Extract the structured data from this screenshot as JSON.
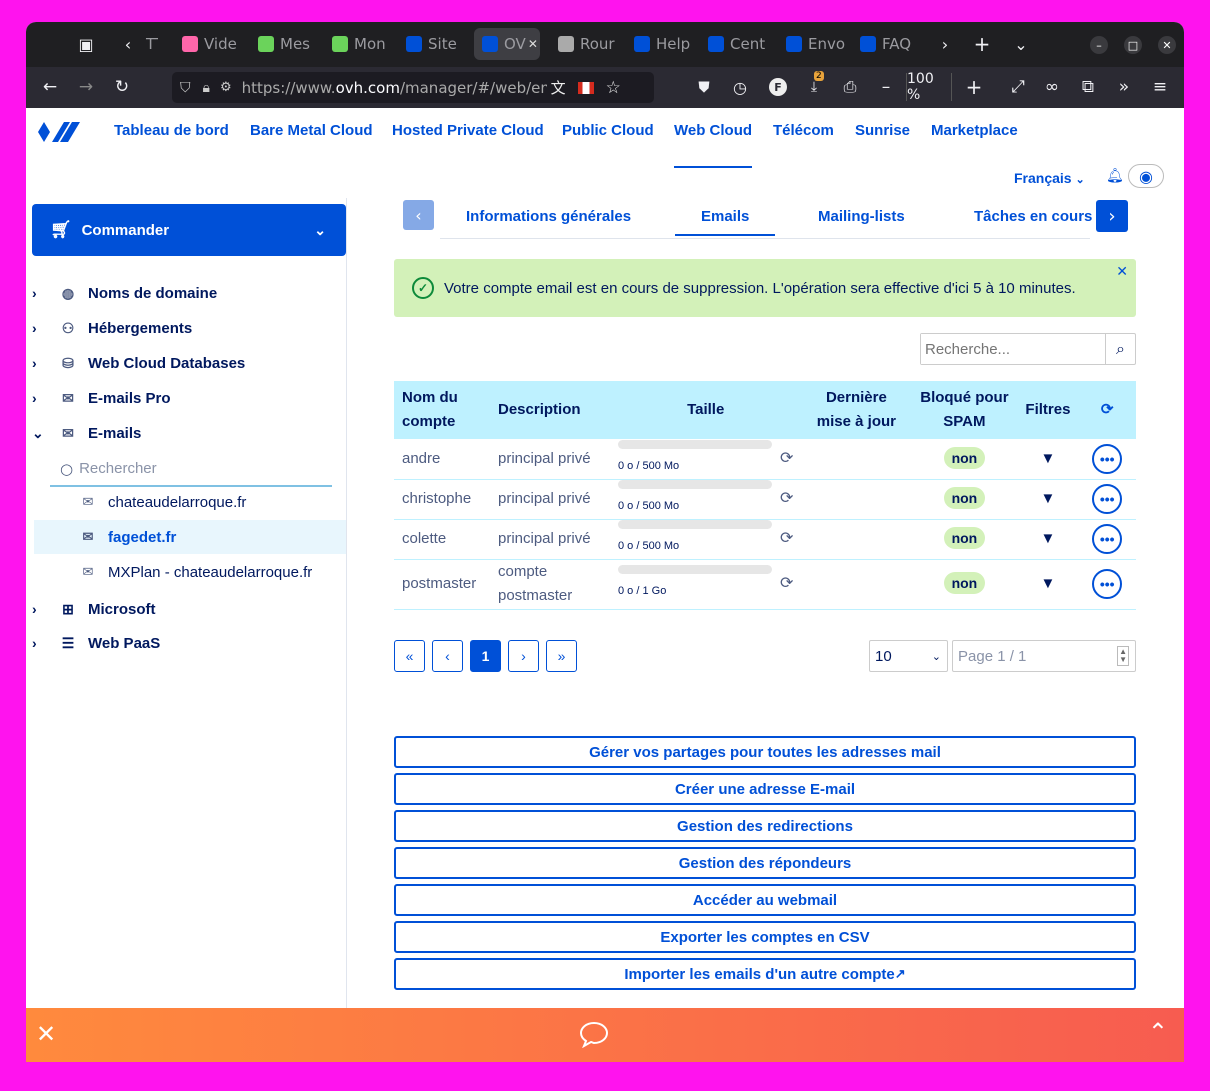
{
  "browser": {
    "tabs": [
      {
        "label": "TT",
        "color": "#9b9ba0"
      },
      {
        "label": "Vide",
        "color": "#f6a"
      },
      {
        "label": "Mes",
        "color": "#6bd35b"
      },
      {
        "label": "Mon",
        "color": "#6bd35b"
      },
      {
        "label": "Site",
        "color": "#0050d7"
      },
      {
        "label": "OV",
        "color": "#0050d7"
      },
      {
        "label": "Rour",
        "color": "#aaa"
      },
      {
        "label": "Help",
        "color": "#0050d7"
      },
      {
        "label": "Cent",
        "color": "#0050d7"
      },
      {
        "label": "Envo",
        "color": "#0050d7"
      },
      {
        "label": "FAQ",
        "color": "#0050d7"
      }
    ],
    "url_prefix": "https://www.",
    "url_domain": "ovh.com",
    "url_path": "/manager/#/web/ema",
    "zoom": "100 %",
    "downloads_badge": "2"
  },
  "ovh_nav": {
    "items": [
      "Tableau de bord",
      "Bare Metal Cloud",
      "Hosted Private Cloud",
      "Public Cloud",
      "Web Cloud",
      "Télécom",
      "Sunrise",
      "Marketplace"
    ],
    "active": "Web Cloud",
    "language": "Français"
  },
  "sidebar": {
    "order_label": "Commander",
    "items": [
      {
        "label": "Noms de domaine",
        "icon": "globe-icon"
      },
      {
        "label": "Hébergements",
        "icon": "hosting-icon"
      },
      {
        "label": "Web Cloud Databases",
        "icon": "database-icon"
      },
      {
        "label": "E-mails Pro",
        "icon": "envelope-icon"
      },
      {
        "label": "E-mails",
        "icon": "envelope-icon"
      }
    ],
    "search_placeholder": "Rechercher",
    "email_domains": [
      "chateaudelarroque.fr",
      "fagedet.fr",
      "MXPlan - chateaudelarroque.fr"
    ],
    "bottom_items": [
      {
        "label": "Microsoft",
        "icon": "windows-icon"
      },
      {
        "label": "Web PaaS",
        "icon": "stack-icon"
      }
    ]
  },
  "tabs": [
    "Informations générales",
    "Emails",
    "Mailing-lists",
    "Tâches en cours"
  ],
  "alert": {
    "message": "Votre compte email est en cours de suppression. L'opération sera effective d'ici 5 à 10 minutes.",
    "color": "#d3f1b9"
  },
  "search": {
    "placeholder": "Recherche..."
  },
  "table": {
    "headers": [
      "Nom du compte",
      "Description",
      "Taille",
      "Dernière mise à jour",
      "Bloqué pour SPAM",
      "Filtres"
    ],
    "rows": [
      {
        "name": "andre",
        "description": "principal privé",
        "size": "0 o / 500 Mo",
        "spam": "non"
      },
      {
        "name": "christophe",
        "description": "principal privé",
        "size": "0 o / 500 Mo",
        "spam": "non"
      },
      {
        "name": "colette",
        "description": "principal privé",
        "size": "0 o / 500 Mo",
        "spam": "non"
      },
      {
        "name": "postmaster",
        "description": "compte postmaster",
        "size": "0 o / 1 Go",
        "spam": "non"
      }
    ]
  },
  "pagination": {
    "first": "«",
    "prev": "‹",
    "current": "1",
    "next": "›",
    "last": "»",
    "page_size": "10",
    "page_label": "Page 1 / 1"
  },
  "actions": [
    "Gérer vos partages pour toutes les adresses mail",
    "Créer une adresse E-mail",
    "Gestion des redirections",
    "Gestion des répondeurs",
    "Accéder au webmail",
    "Exporter les comptes en CSV",
    "Importer les emails d'un autre compte"
  ],
  "colors": {
    "primary": "#0050d7",
    "navy": "#00185e",
    "table_header": "#bef1ff",
    "success": "#d3f1b9",
    "background": "#ff13ee"
  }
}
